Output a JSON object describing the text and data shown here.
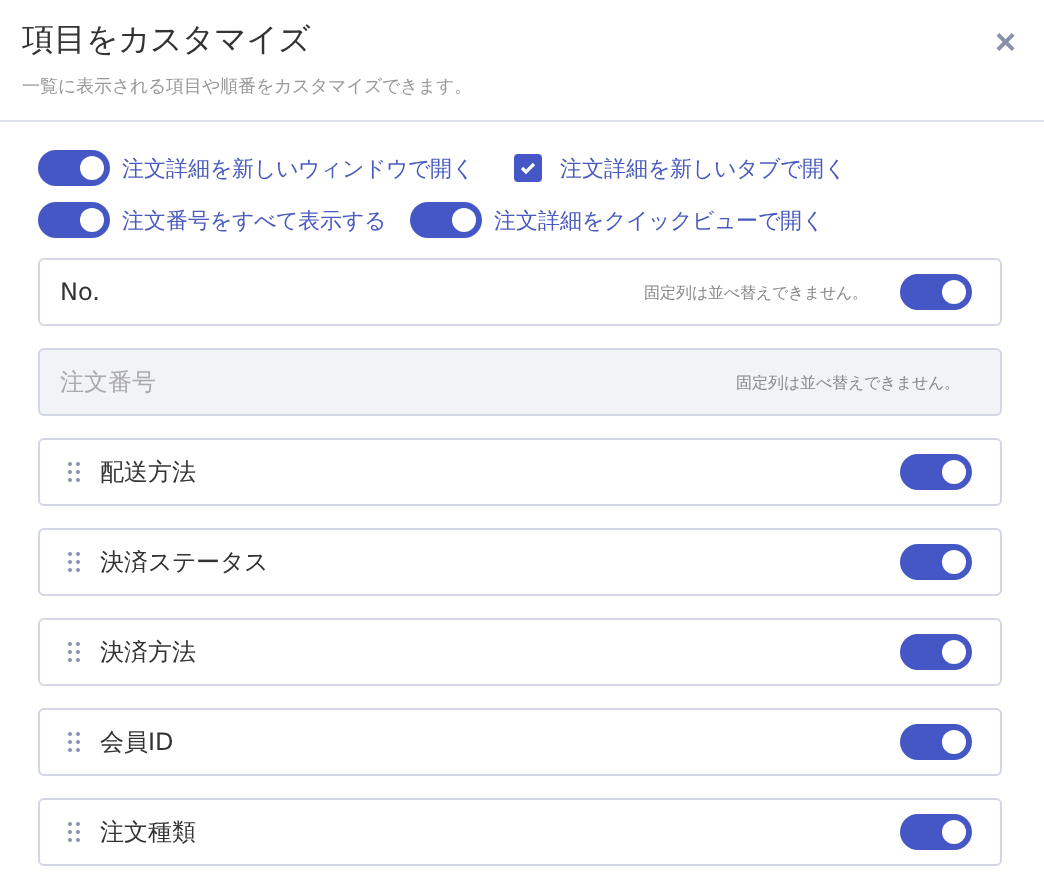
{
  "dialog": {
    "title": "項目をカスタマイズ",
    "subtitle": "一覧に表示される項目や順番をカスタマイズできます。",
    "close": "×"
  },
  "options": [
    {
      "kind": "toggle",
      "label": "注文詳細を新しいウィンドウで開く",
      "on": true
    },
    {
      "kind": "checkbox",
      "label": "注文詳細を新しいタブで開く",
      "checked": true
    },
    {
      "kind": "toggle",
      "label": "注文番号をすべて表示する",
      "on": true
    },
    {
      "kind": "toggle",
      "label": "注文詳細をクイックビューで開く",
      "on": true
    }
  ],
  "columns": [
    {
      "kind": "fixed",
      "label": "No.",
      "note": "固定列は並べ替えできません。",
      "on": true
    },
    {
      "kind": "locked",
      "label": "注文番号",
      "note": "固定列は並べ替えできません。"
    },
    {
      "kind": "sortable",
      "label": "配送方法",
      "on": true
    },
    {
      "kind": "sortable",
      "label": "決済ステータス",
      "on": true
    },
    {
      "kind": "sortable",
      "label": "決済方法",
      "on": true
    },
    {
      "kind": "sortable",
      "label": "会員ID",
      "on": true
    },
    {
      "kind": "sortable",
      "label": "注文種類",
      "on": true
    }
  ]
}
